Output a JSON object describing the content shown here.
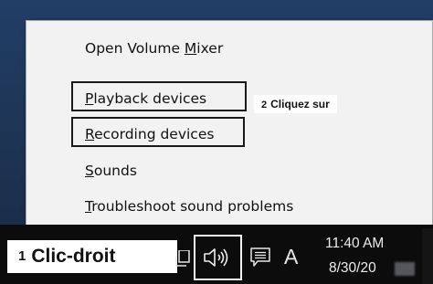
{
  "menu": {
    "items": [
      {
        "pre": "Open Volume ",
        "key": "M",
        "post": "ixer"
      },
      {
        "pre": "",
        "key": "P",
        "post": "layback devices"
      },
      {
        "pre": "",
        "key": "R",
        "post": "ecording devices"
      },
      {
        "pre": "",
        "key": "S",
        "post": "ounds"
      },
      {
        "pre": "",
        "key": "T",
        "post": "roubleshoot sound problems"
      }
    ]
  },
  "annotations": {
    "step1": {
      "num": "1",
      "text": "Clic-droit"
    },
    "step2": {
      "num": "2",
      "text": "Cliquez sur"
    },
    "box_color": "#1a1a1a"
  },
  "taskbar": {
    "ime": "A",
    "time": "11:40 AM",
    "date": "8/30/20",
    "icons": [
      "network-icon",
      "speaker-icon",
      "action-center-icon"
    ]
  }
}
